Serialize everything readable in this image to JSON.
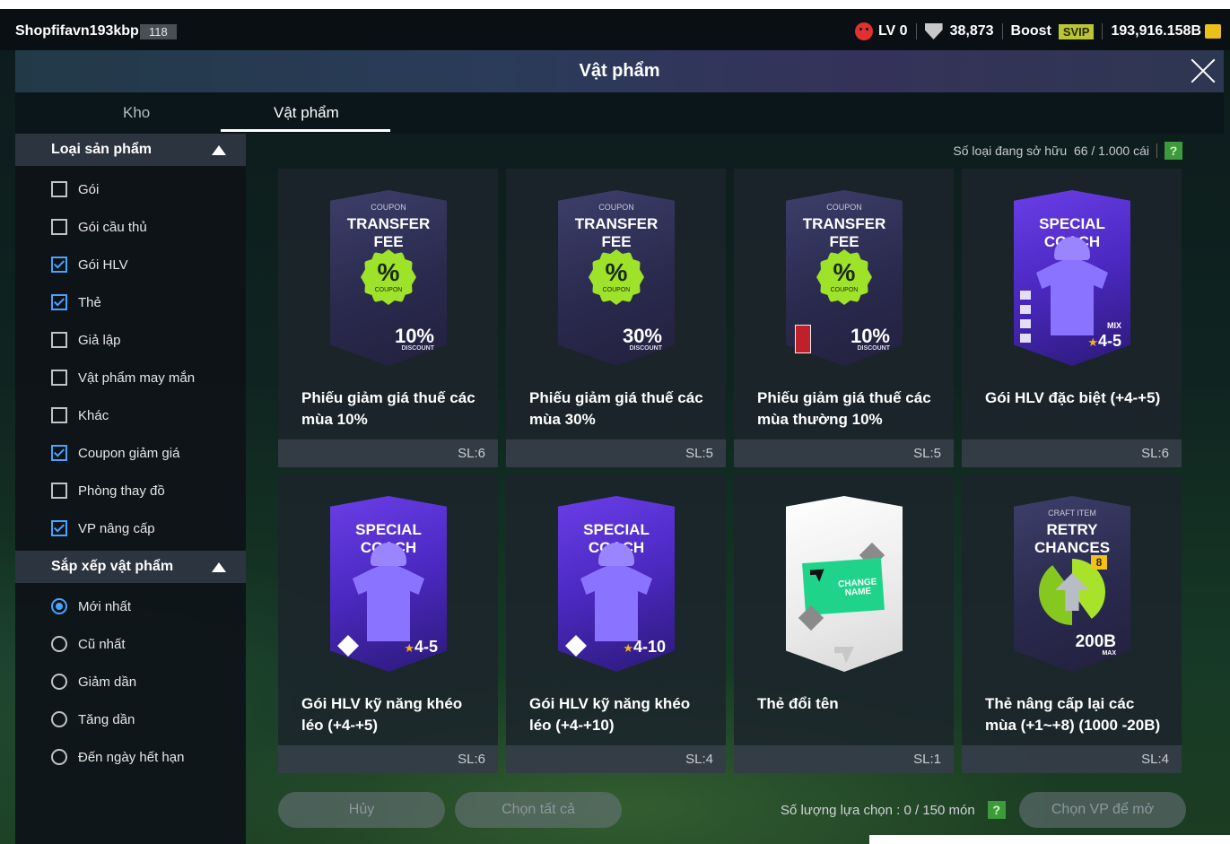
{
  "status": {
    "username": "Shopfifavn193kbp",
    "user_level": "118",
    "lv": "LV 0",
    "points": "38,873",
    "boost_label": "Boost",
    "svip_label": "SVIP",
    "currency": "193,916.158B"
  },
  "window": {
    "title": "Vật phẩm"
  },
  "tabs": [
    {
      "label": "Kho",
      "active": false
    },
    {
      "label": "Vật phẩm",
      "active": true
    }
  ],
  "filters": {
    "product_type_title": "Loại sản phẩm",
    "product_types": [
      {
        "label": "Gói",
        "checked": false
      },
      {
        "label": "Gói cầu thủ",
        "checked": false
      },
      {
        "label": "Gói HLV",
        "checked": true
      },
      {
        "label": "Thẻ",
        "checked": true
      },
      {
        "label": "Giả lập",
        "checked": false
      },
      {
        "label": "Vật phẩm may mắn",
        "checked": false
      },
      {
        "label": "Khác",
        "checked": false
      },
      {
        "label": "Coupon giảm giá",
        "checked": true
      },
      {
        "label": "Phòng thay đồ",
        "checked": false
      },
      {
        "label": "VP nâng cấp",
        "checked": true
      }
    ],
    "sort_title": "Sắp xếp vật phẩm",
    "sort_options": [
      {
        "label": "Mới nhất",
        "selected": true
      },
      {
        "label": "Cũ nhất",
        "selected": false
      },
      {
        "label": "Giảm dần",
        "selected": false
      },
      {
        "label": "Tăng dần",
        "selected": false
      },
      {
        "label": "Đến ngày hết hạn",
        "selected": false
      }
    ]
  },
  "owned": {
    "label": "Số loại đang sở hữu",
    "value": "66 / 1.000 cái",
    "help": "?"
  },
  "items": [
    {
      "name": "Phiếu giảm giá thuế các mùa 10%",
      "qty": "SL:6",
      "pack_small": "COUPON",
      "pack_title": "TRANSFER FEE",
      "badge": "%",
      "badge_sub": "COUPON",
      "discount": "10%",
      "discount_label": "DISCOUNT"
    },
    {
      "name": "Phiếu giảm giá thuế các mùa 30%",
      "qty": "SL:5",
      "pack_small": "COUPON",
      "pack_title": "TRANSFER FEE",
      "badge": "%",
      "badge_sub": "COUPON",
      "discount": "30%",
      "discount_label": "DISCOUNT"
    },
    {
      "name": "Phiếu giảm giá thuế các mùa thường 10%",
      "qty": "SL:5",
      "pack_small": "COUPON",
      "pack_title": "TRANSFER FEE",
      "badge": "%",
      "badge_sub": "COUPON",
      "discount": "10%",
      "discount_label": "DISCOUNT"
    },
    {
      "name": "Gói HLV đặc biệt (+4-+5)",
      "qty": "SL:6",
      "pack_title": "SPECIAL COACH",
      "mix": "MIX",
      "range": "4-5"
    },
    {
      "name": "Gói HLV kỹ năng khéo léo (+4-+5)",
      "qty": "SL:6",
      "pack_title": "SPECIAL COACH",
      "range": "4-5"
    },
    {
      "name": "Gói HLV kỹ năng khéo léo (+4-+10)",
      "qty": "SL:4",
      "pack_title": "SPECIAL COACH",
      "range": "4-10"
    },
    {
      "name": "Thẻ đổi tên",
      "qty": "SL:1",
      "ticket_text": "CHANGE NAME"
    },
    {
      "name": "Thẻ nâng cấp lại các mùa (+1~+8) (1000 -20B)",
      "qty": "SL:4",
      "pack_small": "CRAFT ITEM",
      "pack_title": "RETRY CHANCES",
      "level": "8",
      "max_value": "200B",
      "max_label": "MAX"
    }
  ],
  "bottom": {
    "cancel": "Hủy",
    "select_all": "Chọn tất cả",
    "selection_label": "Số lượng lựa chọn : 0 / 150 món",
    "open": "Chọn VP để mở",
    "help": "?"
  }
}
